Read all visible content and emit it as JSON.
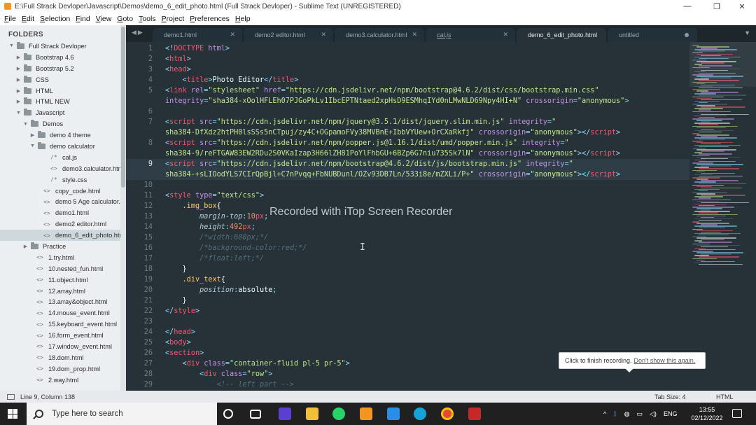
{
  "window": {
    "title": "E:\\Full Strack Devloper\\Javascript\\Demos\\demo_6_edit_photo.html (Full Strack Devloper) - Sublime Text (UNREGISTERED)",
    "minimize": "—",
    "maximize": "❐",
    "close": "✕"
  },
  "menu": [
    "File",
    "Edit",
    "Selection",
    "Find",
    "View",
    "Goto",
    "Tools",
    "Project",
    "Preferences",
    "Help"
  ],
  "sidebar": {
    "title": "FOLDERS",
    "tree": [
      {
        "label": "Full Strack Devloper",
        "type": "folder",
        "depth": 0,
        "open": true
      },
      {
        "label": "Bootstrap 4.6",
        "type": "folder",
        "depth": 1,
        "open": false
      },
      {
        "label": "Bootstrap 5.2",
        "type": "folder",
        "depth": 1,
        "open": false
      },
      {
        "label": "CSS",
        "type": "folder",
        "depth": 1,
        "open": false
      },
      {
        "label": "HTML",
        "type": "folder",
        "depth": 1,
        "open": false
      },
      {
        "label": "HTML NEW",
        "type": "folder",
        "depth": 1,
        "open": false
      },
      {
        "label": "Javascript",
        "type": "folder",
        "depth": 1,
        "open": true
      },
      {
        "label": "Demos",
        "type": "folder",
        "depth": 2,
        "open": true
      },
      {
        "label": "demo 4 theme",
        "type": "folder",
        "depth": 3,
        "open": false
      },
      {
        "label": "demo calculator",
        "type": "folder",
        "depth": 3,
        "open": true
      },
      {
        "label": "cal.js",
        "type": "js",
        "depth": 4
      },
      {
        "label": "demo3.calculator.htm",
        "type": "html",
        "depth": 4
      },
      {
        "label": "style.css",
        "type": "js",
        "depth": 4
      },
      {
        "label": "copy_code.html",
        "type": "html",
        "depth": 3
      },
      {
        "label": "demo 5 Age calculator.h",
        "type": "html",
        "depth": 3
      },
      {
        "label": "demo1.html",
        "type": "html",
        "depth": 3
      },
      {
        "label": "demo2 editor.html",
        "type": "html",
        "depth": 3
      },
      {
        "label": "demo_6_edit_photo.htm",
        "type": "html",
        "depth": 3,
        "selected": true
      },
      {
        "label": "Practice",
        "type": "folder",
        "depth": 2,
        "open": false
      },
      {
        "label": "1.try.html",
        "type": "html",
        "depth": 2
      },
      {
        "label": "10.nested_fun.html",
        "type": "html",
        "depth": 2
      },
      {
        "label": "11.object.html",
        "type": "html",
        "depth": 2
      },
      {
        "label": "12.array.html",
        "type": "html",
        "depth": 2
      },
      {
        "label": "13.array&object.html",
        "type": "html",
        "depth": 2
      },
      {
        "label": "14.mouse_event.html",
        "type": "html",
        "depth": 2
      },
      {
        "label": "15.keyboard_event.html",
        "type": "html",
        "depth": 2
      },
      {
        "label": "16.form_event.html",
        "type": "html",
        "depth": 2
      },
      {
        "label": "17.window_event.html",
        "type": "html",
        "depth": 2
      },
      {
        "label": "18.dom.html",
        "type": "html",
        "depth": 2
      },
      {
        "label": "19.dom_prop.html",
        "type": "html",
        "depth": 2
      },
      {
        "label": "2.way.html",
        "type": "html",
        "depth": 2
      }
    ]
  },
  "tabs": [
    {
      "label": "demo1.html",
      "active": false,
      "italic": false,
      "dirty": false
    },
    {
      "label": "demo2 editor.html",
      "active": false,
      "italic": false,
      "dirty": false
    },
    {
      "label": "demo3.calculator.html",
      "active": false,
      "italic": false,
      "dirty": false
    },
    {
      "label": "cal.js",
      "active": false,
      "italic": true,
      "dirty": false
    },
    {
      "label": "demo_6_edit_photo.html",
      "active": true,
      "italic": false,
      "dirty": false
    },
    {
      "label": "untitled",
      "active": false,
      "italic": false,
      "dirty": true
    }
  ],
  "editor": {
    "current_line": 9,
    "lines": [
      {
        "n": "1",
        "html": "<span class='p'>&lt;!</span><span class='t'>DOCTYPE</span> <span class='a'>html</span><span class='p'>&gt;</span>"
      },
      {
        "n": "2",
        "html": "<span class='p'>&lt;</span><span class='t'>html</span><span class='p'>&gt;</span>"
      },
      {
        "n": "3",
        "html": "<span class='p'>&lt;</span><span class='t'>head</span><span class='p'>&gt;</span>"
      },
      {
        "n": "4",
        "html": "    <span class='p'>&lt;</span><span class='t'>title</span><span class='p'>&gt;</span>Photo Editor<span class='p'>&lt;/</span><span class='t'>title</span><span class='p'>&gt;</span>"
      },
      {
        "n": "5",
        "html": "<span class='p'>&lt;</span><span class='t'>link</span> <span class='a'>rel</span><span class='p'>=</span><span class='s'>\"stylesheet\"</span> <span class='a'>href</span><span class='p'>=</span><span class='s'>\"https://cdn.jsdelivr.net/npm/bootstrap@4.6.2/dist/css/bootstrap.min.css\"</span>"
      },
      {
        "n": "",
        "html": "<span class='a'>integrity</span><span class='p'>=</span><span class='s'>\"sha384-xOolHFLEh07PJGoPkLv1IbcEPTNtaed2xpHsD9ESMhqIYd0nLMwNLD69Npy4HI+N\"</span> <span class='a'>crossorigin</span><span class='p'>=</span><span class='s'>\"anonymous\"</span><span class='p'>&gt;</span>"
      },
      {
        "n": "6",
        "html": ""
      },
      {
        "n": "7",
        "html": "<span class='p'>&lt;</span><span class='t'>script</span> <span class='a'>src</span><span class='p'>=</span><span class='s'>\"https://cdn.jsdelivr.net/npm/jquery@3.5.1/dist/jquery.slim.min.js\"</span> <span class='a'>integrity</span><span class='p'>=</span><span class='s'>\"</span>"
      },
      {
        "n": "",
        "html": "<span class='s'>sha384-DfXdz2htPH0lsSSs5nCTpuj/zy4C+OGpamoFVy38MVBnE+IbbVYUew+OrCXaRkfj\"</span> <span class='a'>crossorigin</span><span class='p'>=</span><span class='s'>\"anonymous\"</span><span class='p'>&gt;&lt;/</span><span class='t'>script</span><span class='p'>&gt;</span>"
      },
      {
        "n": "8",
        "html": "<span class='p'>&lt;</span><span class='t'>script</span> <span class='a'>src</span><span class='p'>=</span><span class='s'>\"https://cdn.jsdelivr.net/npm/popper.js@1.16.1/dist/umd/popper.min.js\"</span> <span class='a'>integrity</span><span class='p'>=</span><span class='s'>\"</span>"
      },
      {
        "n": "",
        "html": "<span class='s'>sha384-9/reFTGAW83EW2RDu2S0VKaIzap3H66lZH81PoYlFhbGU+6BZp6G7niu735Sk7lN\"</span> <span class='a'>crossorigin</span><span class='p'>=</span><span class='s'>\"anonymous\"</span><span class='p'>&gt;&lt;/</span><span class='t'>script</span><span class='p'>&gt;</span>"
      },
      {
        "n": "9",
        "html": "<span class='p'>&lt;</span><span class='t'>script</span> <span class='a'>src</span><span class='p'>=</span><span class='s'>\"https://cdn.jsdelivr.net/npm/bootstrap@4.6.2/dist/js/bootstrap.min.js\"</span> <span class='a'>integrity</span><span class='p'>=</span><span class='s'>\"</span>",
        "cur": true
      },
      {
        "n": "",
        "html": "<span class='s'>sha384-+sLIOodYLS7CIrQpBjl+C7nPvqq+FbNUBDunl/OZv93DB7Ln/533i8e/mZXLi/P+\"</span> <span class='a'>crossorigin</span><span class='p'>=</span><span class='s'>\"anonymous\"</span><span class='p'>&gt;&lt;/</span><span class='t'>script</span><span class='p'>&gt;</span>"
      },
      {
        "n": "10",
        "html": ""
      },
      {
        "n": "11",
        "html": "<span class='p'>&lt;</span><span class='t'>style</span> <span class='a'>type</span><span class='p'>=</span><span class='s'>\"text/css\"</span><span class='p'>&gt;</span>"
      },
      {
        "n": "12",
        "html": "    <span class='sl'>.img_box</span><span class='d'>{</span>"
      },
      {
        "n": "13",
        "html": "        <span class='pr'>margin-top</span><span class='p'>:</span><span class='n'>10</span><span class='t'>px</span><span class='p'>;</span>"
      },
      {
        "n": "14",
        "html": "        <span class='pr'>height</span><span class='p'>:</span><span class='n'>492</span><span class='t'>px</span><span class='p'>;</span>"
      },
      {
        "n": "15",
        "html": "        <span class='c'>/*width:600px;*/</span>"
      },
      {
        "n": "16",
        "html": "        <span class='c'>/*background-color:red;*/</span>"
      },
      {
        "n": "17",
        "html": "        <span class='c'>/*float:left;*/</span>"
      },
      {
        "n": "18",
        "html": "    <span class='d'>}</span>"
      },
      {
        "n": "19",
        "html": "    <span class='sl'>.div_text</span><span class='d'>{</span>"
      },
      {
        "n": "20",
        "html": "        <span class='pr'>position</span><span class='p'>:</span><span class='d'>absolute</span><span class='p'>;</span>"
      },
      {
        "n": "21",
        "html": "    <span class='d'>}</span>"
      },
      {
        "n": "22",
        "html": "<span class='p'>&lt;/</span><span class='t'>style</span><span class='p'>&gt;</span>"
      },
      {
        "n": "23",
        "html": ""
      },
      {
        "n": "24",
        "html": "<span class='p'>&lt;/</span><span class='t'>head</span><span class='p'>&gt;</span>"
      },
      {
        "n": "25",
        "html": "<span class='p'>&lt;</span><span class='t'>body</span><span class='p'>&gt;</span>"
      },
      {
        "n": "26",
        "html": "<span class='p'>&lt;</span><span class='t'>section</span><span class='p'>&gt;</span>"
      },
      {
        "n": "27",
        "html": "    <span class='p'>&lt;</span><span class='t'>div</span> <span class='a'>class</span><span class='p'>=</span><span class='s'>\"container-fluid pl-5 pr-5\"</span><span class='p'>&gt;</span>"
      },
      {
        "n": "28",
        "html": "        <span class='p'>&lt;</span><span class='t'>div</span> <span class='a'>class</span><span class='p'>=</span><span class='s'>\"row\"</span><span class='p'>&gt;</span>"
      },
      {
        "n": "29",
        "html": "            <span class='c'>&lt;!-- left part --&gt;</span>"
      }
    ]
  },
  "overlay": {
    "watermark": "Recorded with iTop Screen Recorder",
    "notification_text": "Click to finish recording.",
    "notification_link": "Don't show this again."
  },
  "statusbar": {
    "position": "Line 9, Column 138",
    "tab_size": "Tab Size: 4",
    "syntax": "HTML"
  },
  "taskbar": {
    "search_placeholder": "Type here to search",
    "language": "ENG",
    "time": "13:55",
    "date": "02/12/2022"
  },
  "colors": {
    "editor_bg": "#263238",
    "sidebar_bg": "#eceff1",
    "tag": "#ff5370",
    "attribute": "#c792ea",
    "string": "#c3e88d",
    "punctuation": "#89ddff",
    "comment": "#546e7a"
  }
}
